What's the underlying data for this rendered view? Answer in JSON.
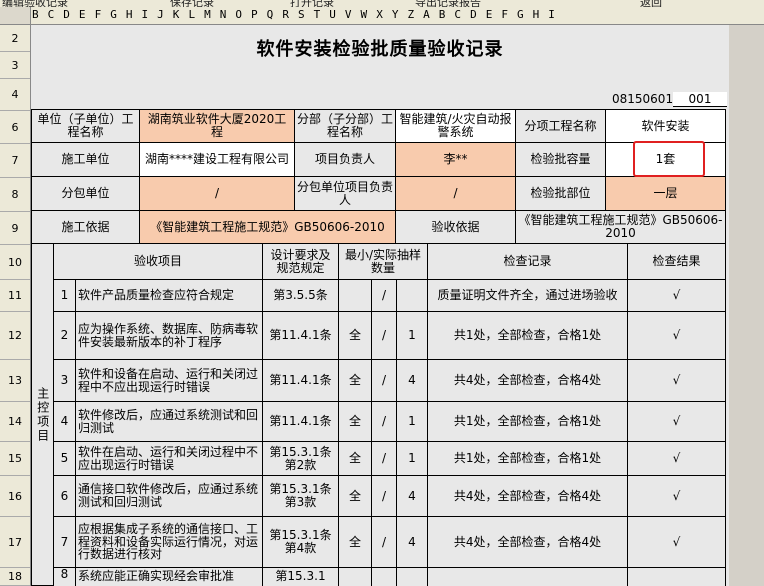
{
  "toolbar": [
    "编辑验收记录",
    "保存记录",
    "打开记录",
    "导出记录报告",
    "返回"
  ],
  "column_letters": "B C D E F G H I J K L M N O P Q R S T U V W X Y Z A B C D E F G H I",
  "row_numbers": [
    "2",
    "3",
    "4",
    "6",
    "7",
    "8",
    "9",
    "10",
    "11",
    "12",
    "13",
    "14",
    "15",
    "16",
    "17",
    "18"
  ],
  "title": "软件安装检验批质量验收记录",
  "code_left": "08150601",
  "code_right": "001",
  "header": {
    "unit_label": "单位（子单位）工程名称",
    "unit_value": "湖南筑业软件大厦2020工程",
    "subunit_label": "分部（子分部）工程名称",
    "subunit_value": "智能建筑/火灾自动报警系统",
    "item_label": "分项工程名称",
    "item_value": "软件安装",
    "builder_label": "施工单位",
    "builder_value": "湖南****建设工程有限公司",
    "manager_label": "项目负责人",
    "manager_value": "李**",
    "capacity_label": "检验批容量",
    "capacity_value": "1套",
    "sub_label": "分包单位",
    "sub_value": "/",
    "sub_manager_label": "分包单位项目负责人",
    "sub_manager_value": "/",
    "part_label": "检验批部位",
    "part_value": "一层",
    "basis_label": "施工依据",
    "basis_value": "《智能建筑工程施工规范》GB50606-2010",
    "accept_label": "验收依据",
    "accept_value": "《智能建筑工程施工规范》GB50606-2010"
  },
  "columns": {
    "item": "验收项目",
    "spec": "设计要求及规范规定",
    "sample": "最小/实际抽样数量",
    "record": "检查记录",
    "result": "检查结果"
  },
  "group_label": "主控项目",
  "rows": [
    {
      "no": "1",
      "item": "软件产品质量检查应符合规定",
      "spec": "第3.5.5条",
      "min": "",
      "slash": "/",
      "actual": "",
      "record": "质量证明文件齐全，通过进场验收",
      "result": "√"
    },
    {
      "no": "2",
      "item": "应为操作系统、数据库、防病毒软件安装最新版本的补丁程序",
      "spec": "第11.4.1条",
      "min": "全",
      "slash": "/",
      "actual": "1",
      "record": "共1处，全部检查，合格1处",
      "result": "√"
    },
    {
      "no": "3",
      "item": "软件和设备在启动、运行和关闭过程中不应出现运行时错误",
      "spec": "第11.4.1条",
      "min": "全",
      "slash": "/",
      "actual": "4",
      "record": "共4处，全部检查，合格4处",
      "result": "√"
    },
    {
      "no": "4",
      "item": "软件修改后，应通过系统测试和回归测试",
      "spec": "第11.4.1条",
      "min": "全",
      "slash": "/",
      "actual": "1",
      "record": "共1处，全部检查，合格1处",
      "result": "√"
    },
    {
      "no": "5",
      "item": "软件在启动、运行和关闭过程中不应出现运行时错误",
      "spec": "第15.3.1条第2款",
      "min": "全",
      "slash": "/",
      "actual": "1",
      "record": "共1处，全部检查，合格1处",
      "result": "√"
    },
    {
      "no": "6",
      "item": "通信接口软件修改后，应通过系统测试和回归测试",
      "spec": "第15.3.1条第3款",
      "min": "全",
      "slash": "/",
      "actual": "4",
      "record": "共4处，全部检查，合格4处",
      "result": "√"
    },
    {
      "no": "7",
      "item": "应根据集成子系统的通信接口、工程资料和设备实际运行情况，对运行数据进行核对",
      "spec": "第15.3.1条第4款",
      "min": "全",
      "slash": "/",
      "actual": "4",
      "record": "共4处，全部检查，合格4处",
      "result": "√"
    },
    {
      "no": "8",
      "item": "系统应能正确实现经会审批准",
      "spec": "第15.3.1",
      "min": "",
      "slash": "",
      "actual": "",
      "record": "",
      "result": ""
    }
  ]
}
